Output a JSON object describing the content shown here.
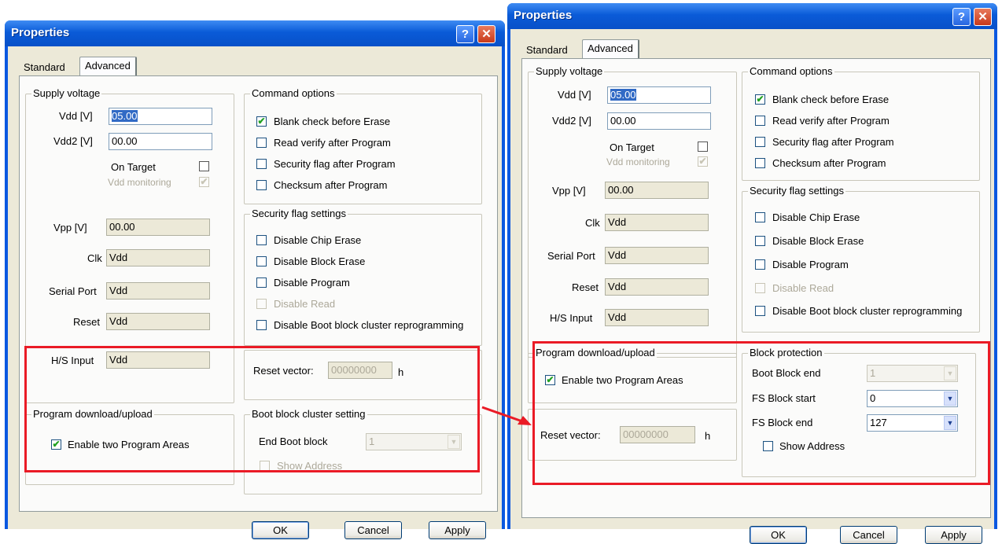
{
  "left": {
    "title": "Properties",
    "help_glyph": "?",
    "close_glyph": "✕",
    "tabs": [
      "Standard",
      "Advanced"
    ],
    "supply_voltage": {
      "label": "Supply voltage",
      "vdd_label": "Vdd [V]",
      "vdd_value": "05.00",
      "vdd2_label": "Vdd2 [V]",
      "vdd2_value": "00.00",
      "on_target_label": "On Target",
      "vdd_monitoring_label": "Vdd monitoring",
      "vpp_label": "Vpp [V]",
      "vpp_value": "00.00",
      "clk_label": "Clk",
      "clk_value": "Vdd",
      "serial_label": "Serial Port",
      "serial_value": "Vdd",
      "reset_label": "Reset",
      "reset_value": "Vdd",
      "hs_label": "H/S Input",
      "hs_value": "Vdd"
    },
    "command_options": {
      "label": "Command options",
      "items": [
        "Blank check before Erase",
        "Read verify after Program",
        "Security flag after Program",
        "Checksum after Program"
      ]
    },
    "security": {
      "label": "Security flag settings",
      "items": [
        "Disable Chip Erase",
        "Disable Block Erase",
        "Disable Program",
        "Disable Read",
        "Disable Boot block cluster reprogramming"
      ]
    },
    "reset_vector": {
      "label": "Reset vector:",
      "value": "00000000",
      "unit": "h"
    },
    "program_download": {
      "label": "Program download/upload",
      "enable_label": "Enable two Program Areas"
    },
    "boot_block": {
      "label": "Boot block cluster setting",
      "end_label": "End Boot block",
      "end_value": "1",
      "show_address": "Show Address"
    },
    "buttons": {
      "ok": "OK",
      "cancel": "Cancel",
      "apply": "Apply"
    }
  },
  "right": {
    "title": "Properties",
    "help_glyph": "?",
    "close_glyph": "✕",
    "tabs": [
      "Standard",
      "Advanced"
    ],
    "supply_voltage": {
      "label": "Supply voltage",
      "vdd_label": "Vdd [V]",
      "vdd_value": "05.00",
      "vdd2_label": "Vdd2 [V]",
      "vdd2_value": "00.00",
      "on_target_label": "On Target",
      "vdd_monitoring_label": "Vdd monitoring",
      "vpp_label": "Vpp [V]",
      "vpp_value": "00.00",
      "clk_label": "Clk",
      "clk_value": "Vdd",
      "serial_label": "Serial Port",
      "serial_value": "Vdd",
      "reset_label": "Reset",
      "reset_value": "Vdd",
      "hs_label": "H/S Input",
      "hs_value": "Vdd"
    },
    "command_options": {
      "label": "Command options",
      "items": [
        "Blank check before Erase",
        "Read verify after Program",
        "Security flag after Program",
        "Checksum after Program"
      ]
    },
    "security": {
      "label": "Security flag settings",
      "items": [
        "Disable Chip Erase",
        "Disable Block Erase",
        "Disable Program",
        "Disable Read",
        "Disable Boot block cluster reprogramming"
      ]
    },
    "program_download": {
      "label": "Program download/upload",
      "enable_label": "Enable two Program Areas"
    },
    "reset_vector": {
      "label": "Reset vector:",
      "value": "00000000",
      "unit": "h"
    },
    "block_protection": {
      "label": "Block protection",
      "boot_end_label": "Boot Block end",
      "boot_end_value": "1",
      "fs_start_label": "FS Block start",
      "fs_start_value": "0",
      "fs_end_label": "FS Block end",
      "fs_end_value": "127",
      "show_address": "Show Address"
    },
    "buttons": {
      "ok": "OK",
      "cancel": "Cancel",
      "apply": "Apply"
    }
  },
  "glyphs": {
    "check": "✔",
    "dropdown": "▼"
  },
  "colors": {
    "highlight_box": "#ea1b26",
    "titlebar": "#0a5bd8"
  }
}
